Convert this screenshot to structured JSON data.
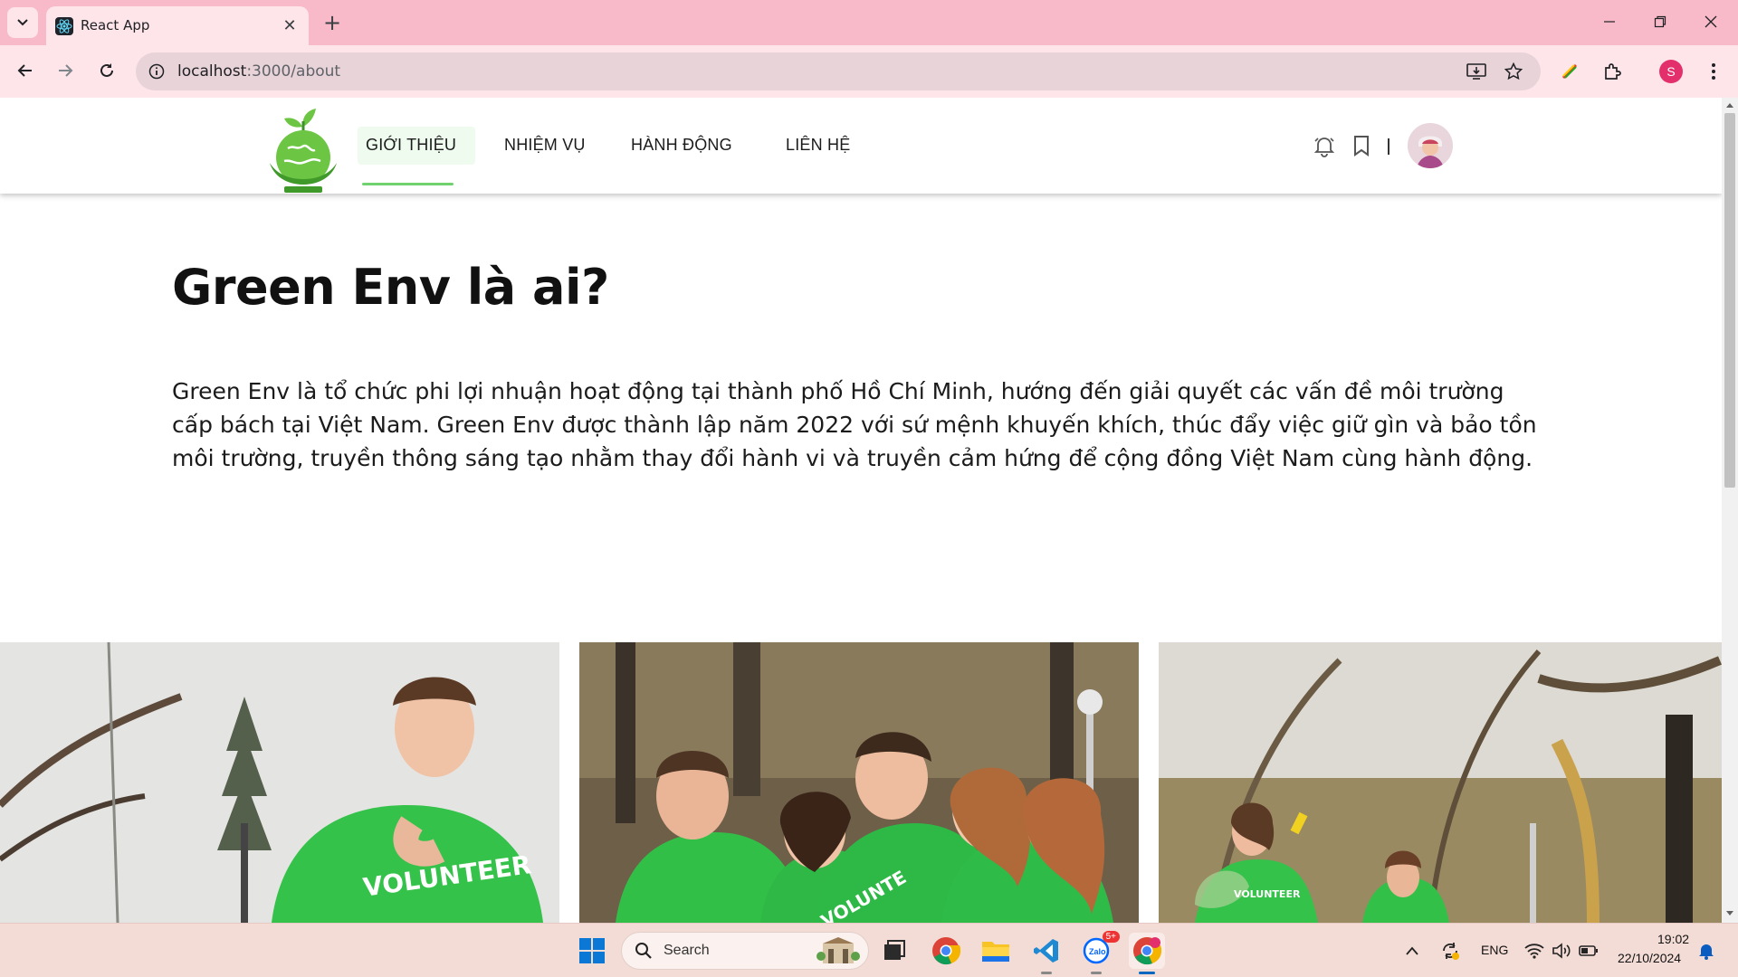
{
  "browser": {
    "tab_title": "React App",
    "url_host": "localhost",
    "url_path": ":3000/about",
    "profile_initial": "S"
  },
  "site": {
    "nav": [
      {
        "label": "GIỚI THIỆU",
        "active": true
      },
      {
        "label": "NHIỆM VỤ",
        "active": false
      },
      {
        "label": "HÀNH ĐỘNG",
        "active": false
      },
      {
        "label": "LIÊN HỆ",
        "active": false
      }
    ],
    "accent_color": "#6fd26f"
  },
  "main": {
    "title": "Green Env là ai?",
    "intro": "Green Env là tổ chức phi lợi nhuận hoạt động tại thành phố Hồ Chí Minh, hướng đến giải quyết các vấn đề môi trường cấp bách tại Việt Nam. Green Env được thành lập năm 2022 với sứ mệnh khuyến khích, thúc đẩy việc giữ gìn và bảo tồn môi trường, truyền thông sáng tạo nhằm thay đổi hành vi và truyền cảm hứng để cộng đồng Việt Nam cùng hành động.",
    "photos": [
      {
        "shirt_text": "VOLUNTEER"
      },
      {
        "shirt_text": "VOLUNTE"
      },
      {
        "shirt_text": "VOLUNTEER"
      }
    ]
  },
  "taskbar": {
    "search_label": "Search",
    "zalo_badge": "5+",
    "language": "ENG",
    "time": "19:02",
    "date": "22/10/2024"
  }
}
